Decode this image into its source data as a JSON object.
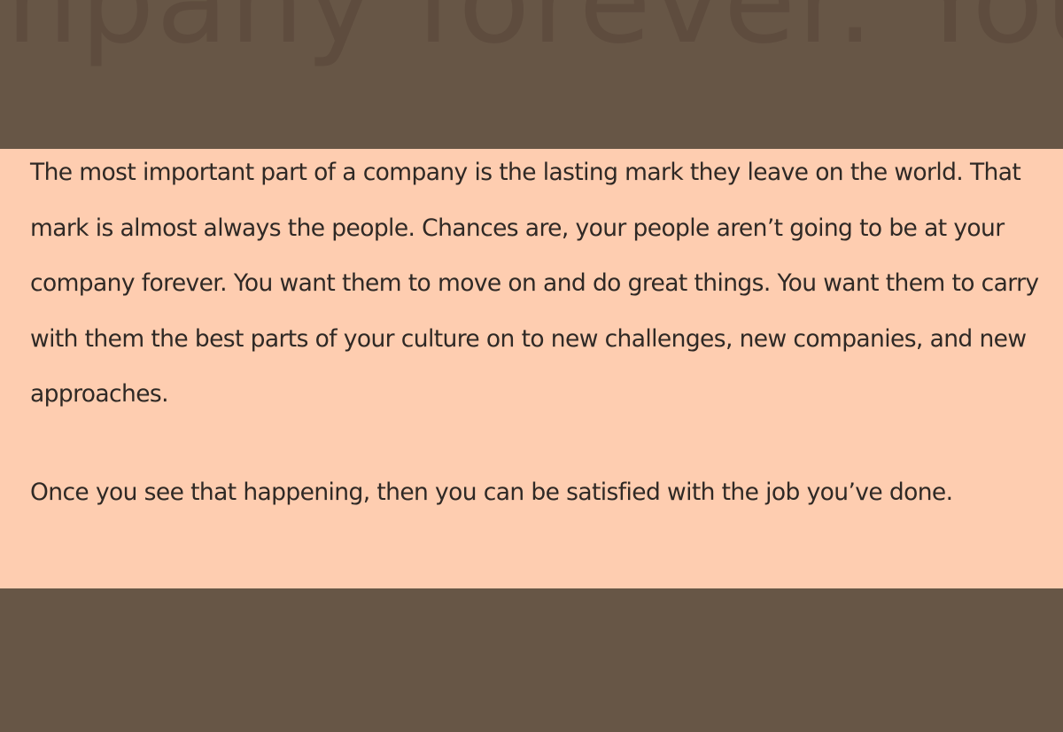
{
  "background": {
    "faded_text": "mpany forever. You"
  },
  "highlight": {
    "paragraphs": [
      "The most important part of a company is the lasting mark they leave on the world. That mark is almost always the people. Chances are, your people aren’t going to be at your company forever. You want them to move on and do great things. You want them to carry with them the best parts of your culture on to new challenges, new companies, and new approaches.",
      "Once you see that happening, then you can be satisfied with the job you’ve done."
    ]
  },
  "colors": {
    "page_background": "#675646",
    "highlight_background": "#fecdb0",
    "text": "#2f2925"
  }
}
